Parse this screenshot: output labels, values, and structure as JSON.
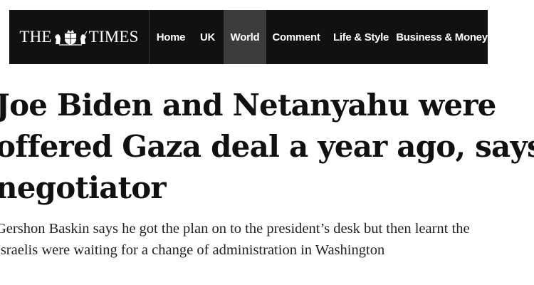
{
  "header": {
    "logo": {
      "text_left": "THE",
      "text_right": "TIMES",
      "crest_icon": "royal-crest-icon"
    },
    "nav": [
      {
        "id": "home",
        "label": "Home",
        "active": false
      },
      {
        "id": "uk",
        "label": "UK",
        "active": false
      },
      {
        "id": "world",
        "label": "World",
        "active": true
      },
      {
        "id": "comment",
        "label": "Comment",
        "active": false
      },
      {
        "id": "life-style",
        "label": "Life & Style",
        "active": false
      },
      {
        "id": "business-money",
        "label": "Business & Money",
        "active": false
      }
    ]
  },
  "article": {
    "headline_lines": [
      "Joe Biden and Netanyahu were",
      "offered Gaza deal a year ago, says",
      "negotiator"
    ],
    "standfirst_lines": [
      "Gershon Baskin says he got the plan on to the president’s desk but then learnt the",
      "Israelis were waiting for a change of administration in Washington"
    ]
  },
  "colors": {
    "nav_background": "#111111",
    "nav_active_background": "#3c3c3c",
    "nav_text": "#ffffff",
    "headline_text": "#111111"
  }
}
